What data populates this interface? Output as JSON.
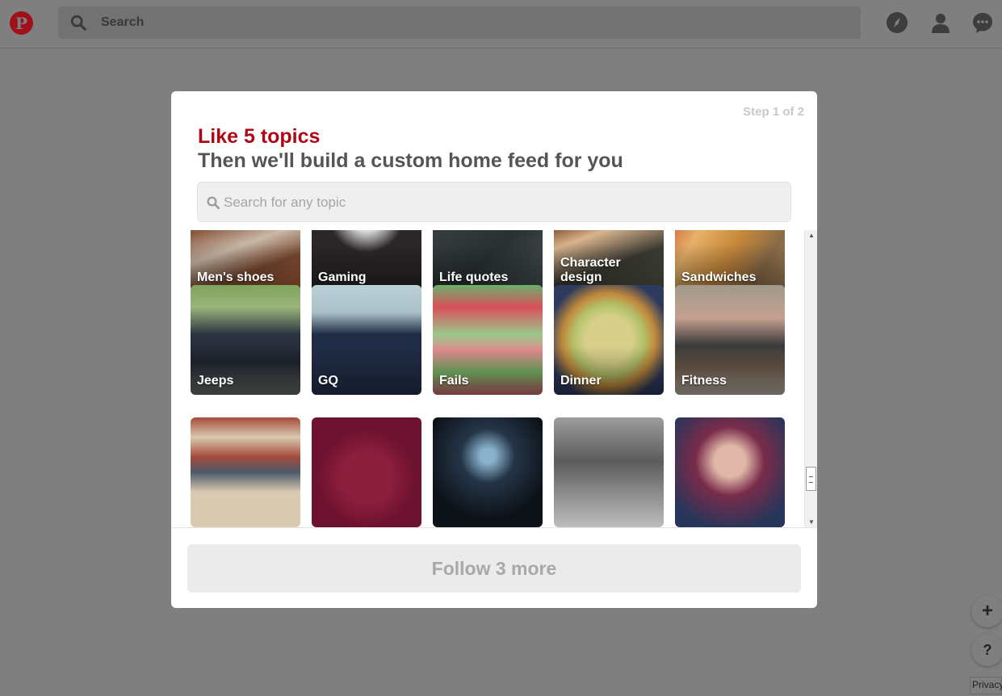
{
  "header": {
    "logo": "P",
    "search_placeholder": "Search",
    "icons": [
      "pinterest-logo",
      "search-icon",
      "explore-compass-icon",
      "profile-icon",
      "messages-icon"
    ]
  },
  "modal": {
    "step": "Step 1 of 2",
    "title": "Like 5 topics",
    "subtitle": "Then we'll build a custom home feed for you",
    "search_placeholder": "Search for any topic",
    "topics": [
      {
        "label": "Men's shoes",
        "row": 0,
        "col": 0
      },
      {
        "label": "Gaming",
        "row": 0,
        "col": 1
      },
      {
        "label": "Life quotes",
        "row": 0,
        "col": 2
      },
      {
        "label": "Character design",
        "row": 0,
        "col": 3
      },
      {
        "label": "Sandwiches",
        "row": 0,
        "col": 4
      },
      {
        "label": "Jeeps",
        "row": 1,
        "col": 0
      },
      {
        "label": "GQ",
        "row": 1,
        "col": 1
      },
      {
        "label": "Fails",
        "row": 1,
        "col": 2
      },
      {
        "label": "Dinner",
        "row": 1,
        "col": 3
      },
      {
        "label": "Fitness",
        "row": 1,
        "col": 4
      },
      {
        "label": "",
        "row": 2,
        "col": 0
      },
      {
        "label": "",
        "row": 2,
        "col": 1
      },
      {
        "label": "",
        "row": 2,
        "col": 2
      },
      {
        "label": "",
        "row": 2,
        "col": 3
      },
      {
        "label": "",
        "row": 2,
        "col": 4
      }
    ],
    "follow_button": "Follow 3 more"
  },
  "floating": {
    "plus": "+",
    "help": "?",
    "privacy": "Privacy"
  },
  "colors": {
    "accent": "#b00716",
    "overlay": "#7f7f7f",
    "title_gray": "#555555"
  }
}
